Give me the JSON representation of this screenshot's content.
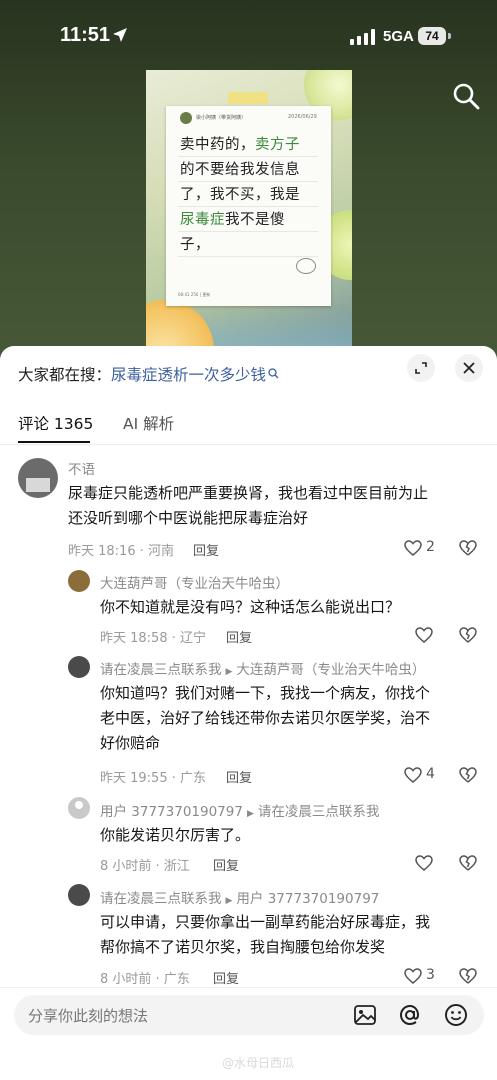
{
  "status_bar": {
    "time": "11:51",
    "network": "5GA",
    "battery": "74"
  },
  "post_image": {
    "note_user": "柒小阿姨（带货阿姨）",
    "note_date": "2026/06/29",
    "note_lines": [
      [
        {
          "t": "卖中药的，",
          "h": false
        },
        {
          "t": "卖方子",
          "h": true
        }
      ],
      [
        {
          "t": "的不要给我发信息",
          "h": false
        }
      ],
      [
        {
          "t": "了，我不买，我是",
          "h": false
        }
      ],
      [
        {
          "t": "尿毒症",
          "h": true
        },
        {
          "t": "我不是傻",
          "h": false
        }
      ],
      [
        {
          "t": "子，",
          "h": false
        }
      ]
    ],
    "note_footer": "08:41  256  |  更新"
  },
  "hot_search": {
    "prefix": "大家都在搜：",
    "query": "尿毒症透析一次多少钱"
  },
  "tabs": {
    "comments": "评论 1365",
    "ai": "AI 解析"
  },
  "comments": [
    {
      "user": "不语",
      "text": [
        "尿毒症只能透析吧严重要换肾，我也看过中医目前为止",
        "还没听到哪个中医说能把尿毒症治好"
      ],
      "meta": "昨天 18:16 · 河南",
      "reply": "回复",
      "likes": "2",
      "avatar_color": "#6b6b6b"
    },
    {
      "user": "大连葫芦哥（专业治天牛哈虫）",
      "text": [
        "你不知道就是没有吗？这种话怎么能说出口？"
      ],
      "meta": "昨天 18:58 · 辽宁",
      "reply": "回复",
      "likes": "",
      "avatar_color": "#8a6d3b"
    },
    {
      "user": "请在凌晨三点联系我",
      "reply_to": "大连葫芦哥（专业治天牛哈虫）",
      "text": [
        "你知道吗？我们对赌一下，我找一个病友，你找个",
        "老中医，治好了给钱还带你去诺贝尔医学奖，治不",
        "好你赔命"
      ],
      "meta": "昨天 19:55 · 广东",
      "reply": "回复",
      "likes": "4",
      "avatar_color": "#4a4a4a"
    },
    {
      "user": "用户 3777370190797",
      "reply_to": "请在凌晨三点联系我",
      "text": [
        "你能发诺贝尔厉害了。"
      ],
      "meta": "8 小时前 · 浙江",
      "reply": "回复",
      "likes": "",
      "avatar_color": "#c9c9c9"
    },
    {
      "user": "请在凌晨三点联系我",
      "reply_to": "用户 3777370190797",
      "text": [
        "可以申请，只要你拿出一副草药能治好尿毒症，我",
        "帮你搞不了诺贝尔奖，我自掏腰包给你发奖"
      ],
      "meta": "8 小时前 · 广东",
      "reply": "回复",
      "likes": "3",
      "avatar_color": "#4a4a4a"
    }
  ],
  "input": {
    "placeholder": "分享你此刻的想法"
  },
  "watermark": "@水母日西瓜"
}
